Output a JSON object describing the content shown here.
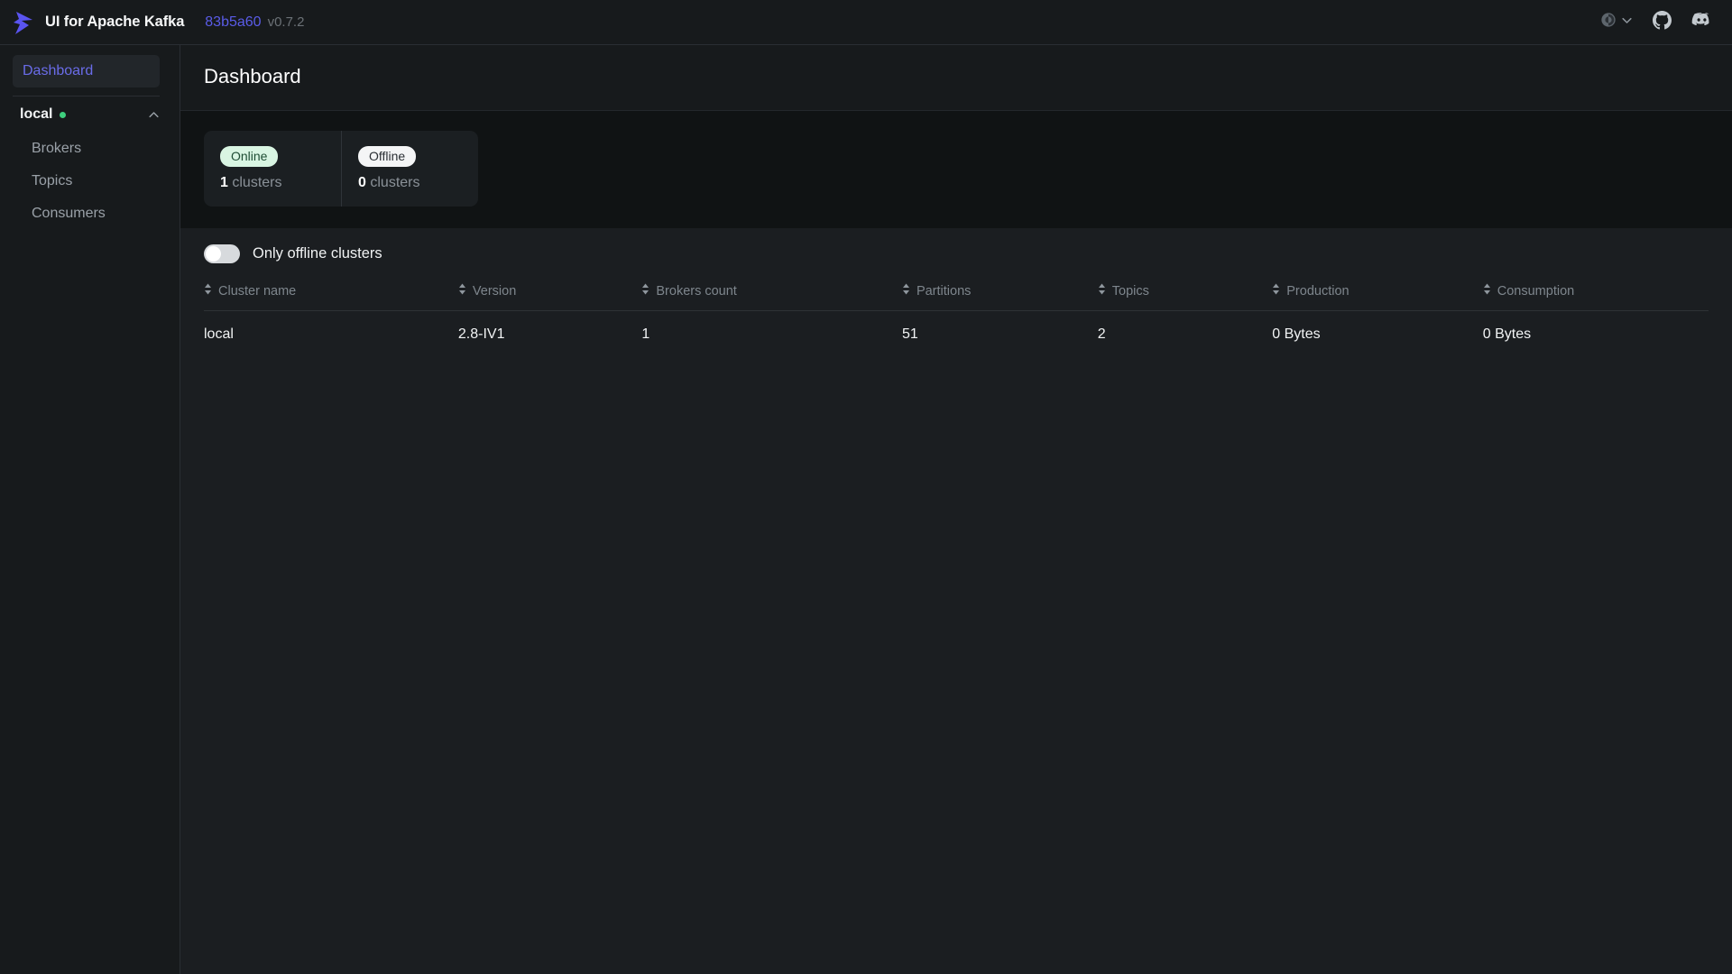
{
  "header": {
    "brand_title": "UI for Apache Kafka",
    "commit": "83b5a60",
    "version": "v0.7.2",
    "icons": {
      "theme": "theme-toggle-icon",
      "chevron": "chevron-down-icon",
      "github": "github-icon",
      "discord": "discord-icon"
    }
  },
  "sidebar": {
    "dashboard_label": "Dashboard",
    "cluster": {
      "name": "local",
      "status": "online",
      "status_color": "#3ecf7e"
    },
    "items": [
      {
        "label": "Brokers"
      },
      {
        "label": "Topics"
      },
      {
        "label": "Consumers"
      }
    ]
  },
  "main": {
    "page_title": "Dashboard",
    "metrics": [
      {
        "badge": "Online",
        "count": "1",
        "unit": "clusters"
      },
      {
        "badge": "Offline",
        "count": "0",
        "unit": "clusters"
      }
    ],
    "toggle": {
      "label": "Only offline clusters",
      "checked": false
    },
    "table": {
      "columns": [
        "Cluster name",
        "Version",
        "Brokers count",
        "Partitions",
        "Topics",
        "Production",
        "Consumption"
      ],
      "rows": [
        {
          "cluster_name": "local",
          "version": "2.8-IV1",
          "brokers_count": "1",
          "partitions": "51",
          "topics": "2",
          "production": "0 Bytes",
          "consumption": "0 Bytes"
        }
      ]
    }
  },
  "colors": {
    "accent": "#5a5ce8",
    "online": "#3ecf7e",
    "header_bg": "#171a1c",
    "content_bg": "#101314",
    "table_bg": "#1b1e21"
  }
}
